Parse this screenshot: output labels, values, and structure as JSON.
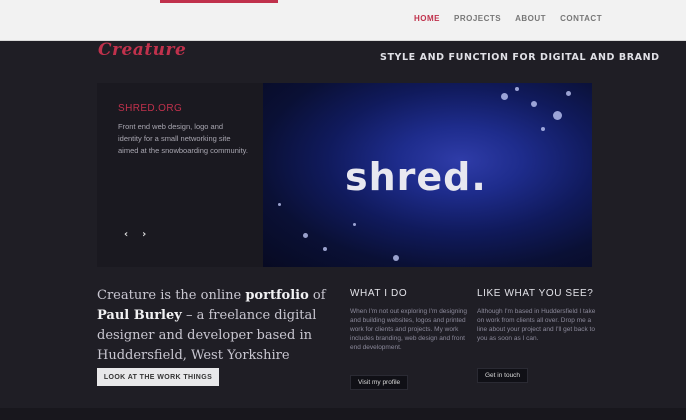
{
  "header": {
    "nav": [
      {
        "label": "HOME",
        "active": true
      },
      {
        "label": "PROJECTS",
        "active": false
      },
      {
        "label": "ABOUT",
        "active": false
      },
      {
        "label": "CONTACT",
        "active": false
      }
    ]
  },
  "brand": {
    "logo": "Creature",
    "tagline": "STYLE AND FUNCTION FOR DIGITAL AND BRAND"
  },
  "feature": {
    "title": "SHRED.ORG",
    "description": "Front end web design, logo and identity for a small networking site aimed at the snowboarding community.",
    "image_text": "shred.",
    "prev_icon": "chevron-left-icon",
    "next_icon": "chevron-right-icon"
  },
  "intro": {
    "part1": "Creature is the online ",
    "bold1": "portfolio",
    "part2": " of ",
    "bold2": "Paul Burley",
    "part3": " – a freelance digital designer and developer based in Huddersfield, West Yorkshire",
    "button": "LOOK AT THE WORK THINGS"
  },
  "columns": [
    {
      "heading": "WHAT I DO",
      "text": "When I'm not out exploring I'm designing and building websites, logos and printed work for clients and projects. My work includes branding, web design and front end development.",
      "button": "Visit my profile"
    },
    {
      "heading": "LIKE WHAT YOU SEE?",
      "text": "Although I'm based in Huddersfield I take on work from clients all over. Drop me a line about your project and I'll get back to you as soon as I can.",
      "button": "Get in touch"
    }
  ],
  "colors": {
    "accent": "#c0314c",
    "background": "#1f1e25",
    "topbar": "#f2f2f2"
  }
}
